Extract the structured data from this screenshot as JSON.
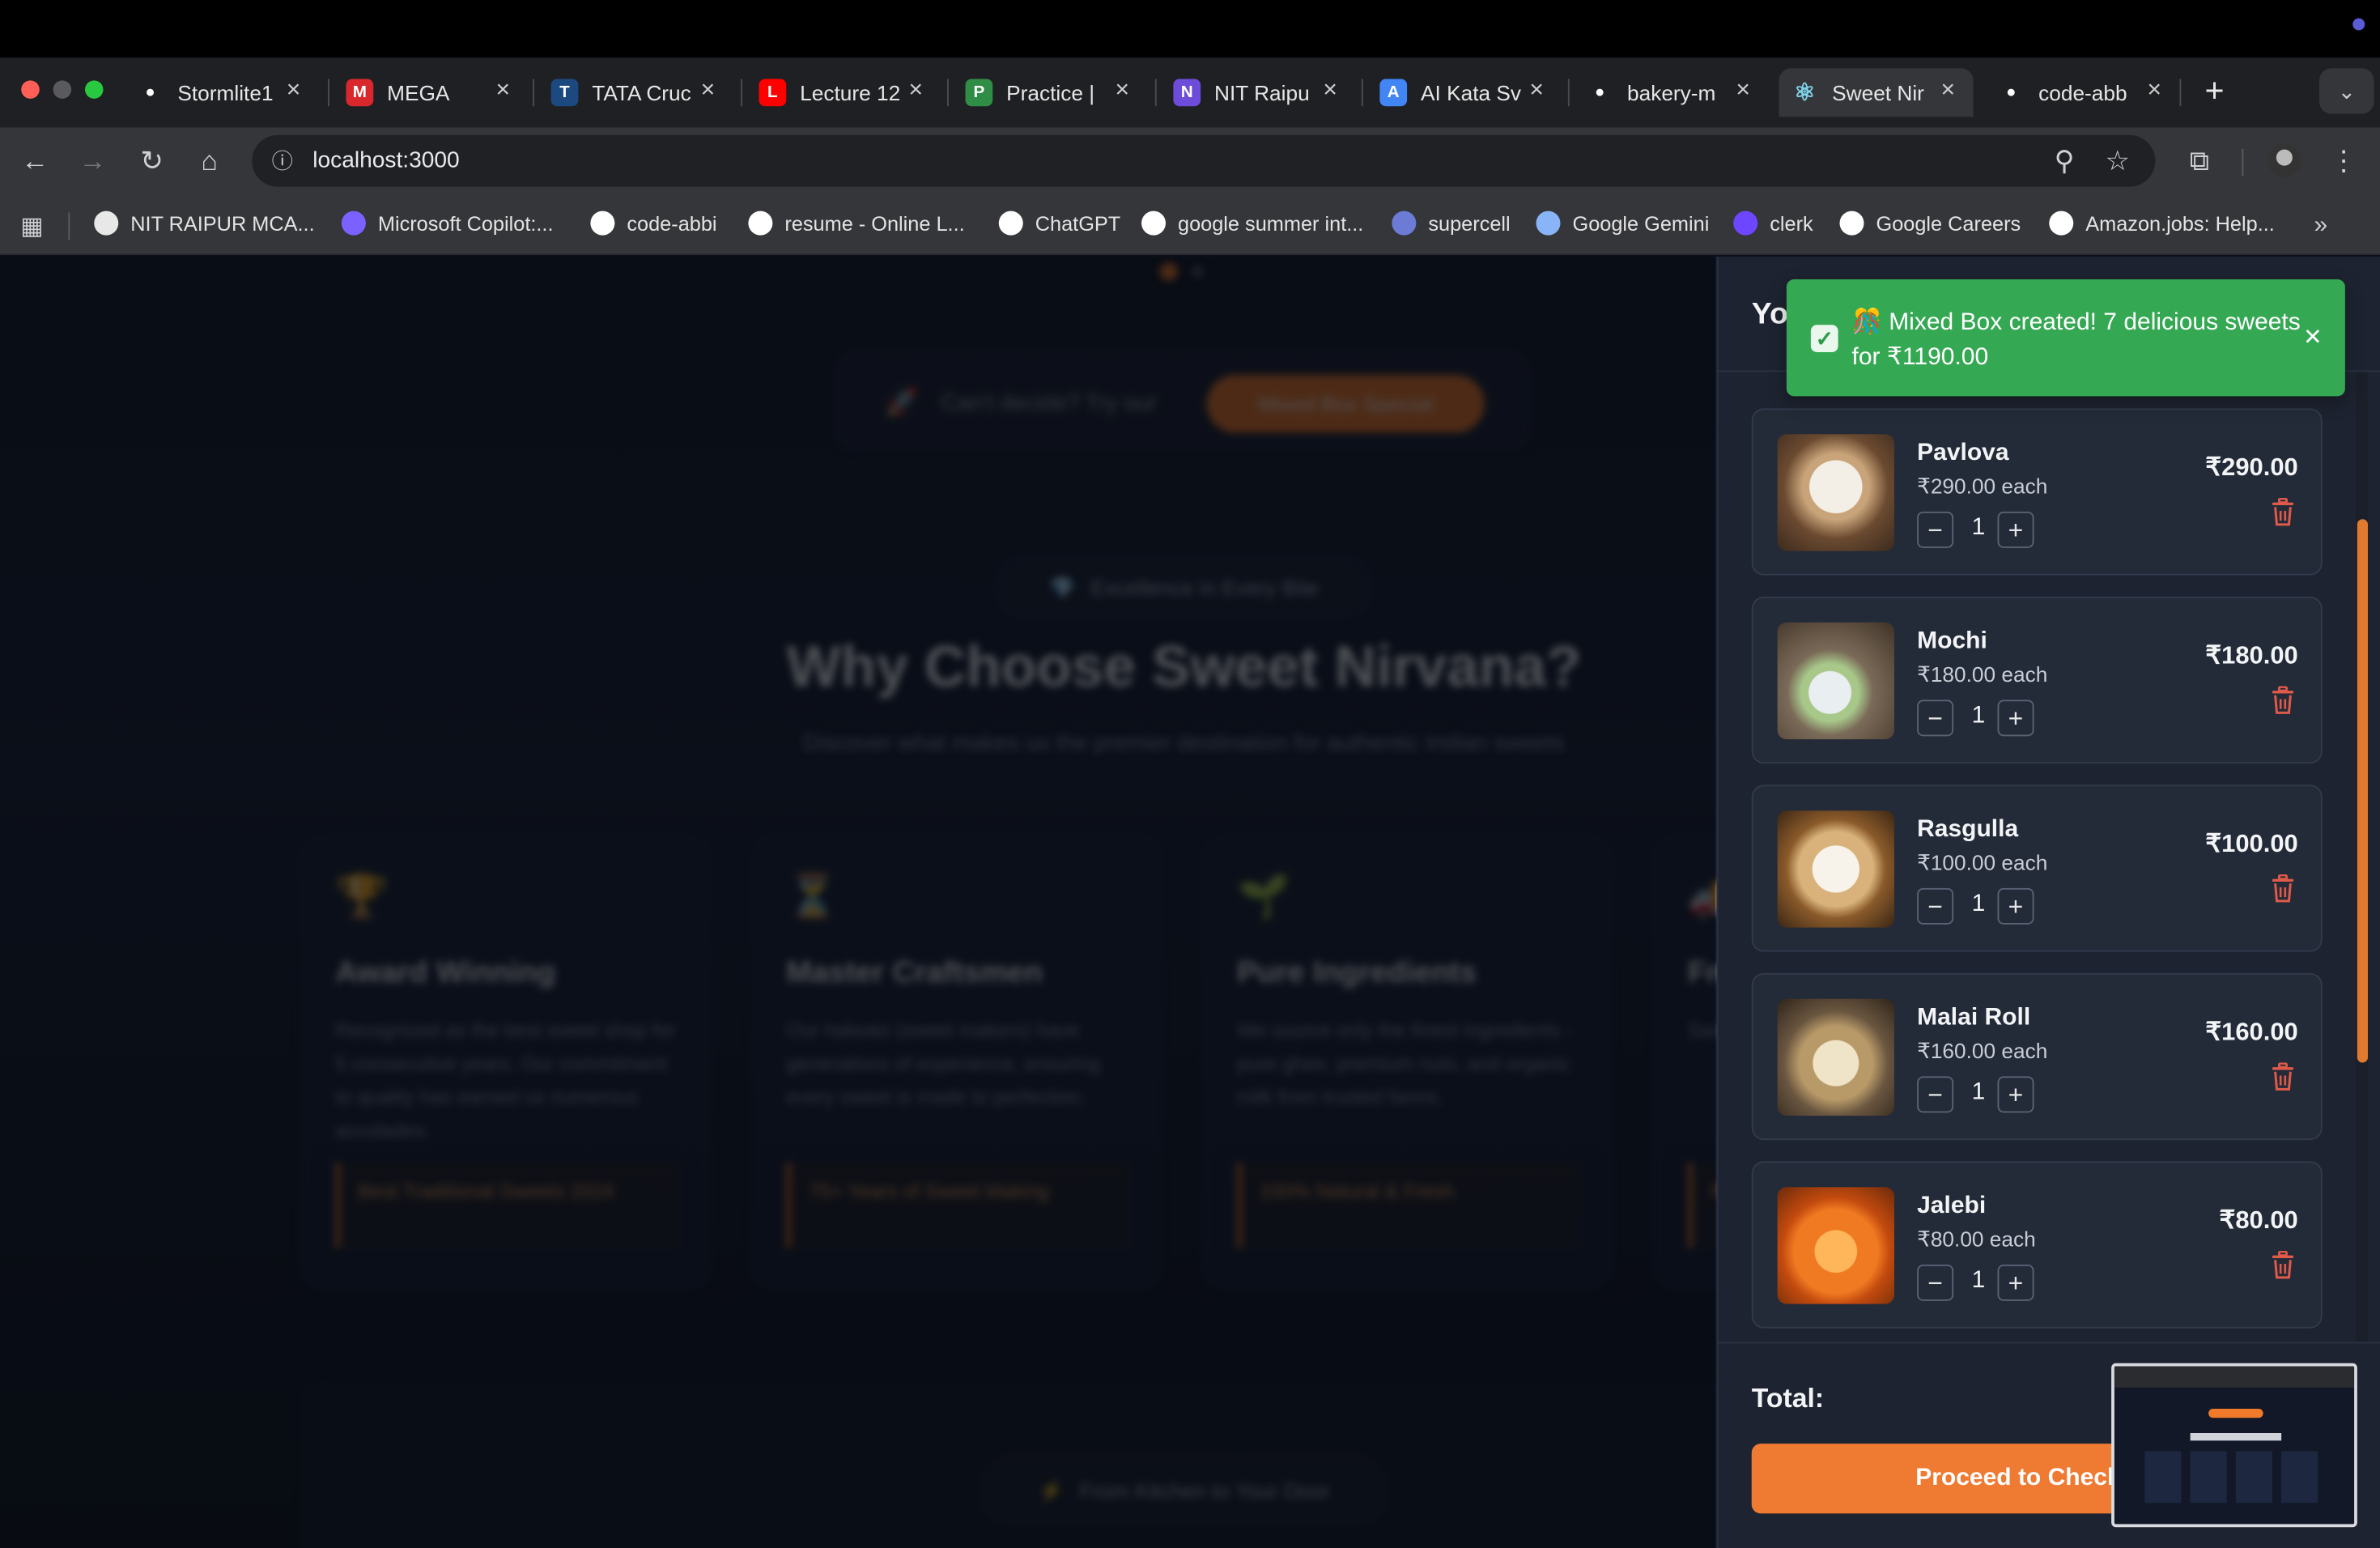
{
  "browser": {
    "tabs": [
      {
        "title": "Stormlite1",
        "icon": "github-icon",
        "color": "#ffffff"
      },
      {
        "title": "MEGA",
        "icon": "mega-icon",
        "color": "#d9272e"
      },
      {
        "title": "TATA Cruc",
        "icon": "unstop-icon",
        "color": "#1c4980"
      },
      {
        "title": "Lecture 12",
        "icon": "youtube-icon",
        "color": "#ff0000"
      },
      {
        "title": "Practice |",
        "icon": "gfg-icon",
        "color": "#2f8d46"
      },
      {
        "title": "NIT Raipu",
        "icon": "form-icon",
        "color": "#6c4cd9"
      },
      {
        "title": "AI Kata Sv",
        "icon": "docs-icon",
        "color": "#4285f4"
      },
      {
        "title": "bakery-m",
        "icon": "github-icon",
        "color": "#ffffff"
      },
      {
        "title": "Sweet Nir",
        "icon": "react-icon",
        "color": "#7fd3e8"
      },
      {
        "title": "code-abb",
        "icon": "github-icon",
        "color": "#ffffff"
      }
    ],
    "url": "localhost:3000",
    "bookmarks": [
      {
        "label": "NIT RAIPUR MCA...",
        "color": "#e8e8e8"
      },
      {
        "label": "Microsoft Copilot:...",
        "color": "#7b61ff"
      },
      {
        "label": "code-abbi",
        "color": "#ffffff"
      },
      {
        "label": "resume - Online L...",
        "color": "#ffffff"
      },
      {
        "label": "ChatGPT",
        "color": "#ffffff"
      },
      {
        "label": "google summer int...",
        "color": "#ffffff"
      },
      {
        "label": "supercell",
        "color": "#6c7bd6"
      },
      {
        "label": "Google Gemini",
        "color": "#8ab4f8"
      },
      {
        "label": "clerk",
        "color": "#6c47ff"
      },
      {
        "label": "Google Careers",
        "color": "#ffffff"
      },
      {
        "label": "Amazon.jobs: Help...",
        "color": "#ffffff"
      }
    ]
  },
  "page": {
    "banner_text": "Can't decide? Try our",
    "banner_button": "Mixed Box Special",
    "pill": "Excellence in Every Bite",
    "heading": "Why Choose Sweet Nirvana?",
    "subheading": "Discover what makes us the premier destination for authentic Indian sweets",
    "features": [
      {
        "icon": "🏆",
        "title": "Award Winning",
        "desc": "Recognized as the best sweet shop for 5 consecutive years. Our commitment to quality has earned us numerous accolades.",
        "badge": "Best Traditional Sweets 2024"
      },
      {
        "icon": "⏳",
        "title": "Master Craftsmen",
        "desc": "Our halwais (sweet makers) have generations of experience, ensuring every sweet is made to perfection.",
        "badge": "75+ Years of Sweet Making"
      },
      {
        "icon": "🌱",
        "title": "Pure Ingredients",
        "desc": "We source only the finest ingredients - pure ghee, premium nuts, and organic milk from trusted farms.",
        "badge": "100% Natural & Fresh"
      },
      {
        "icon": "🚚",
        "title": "Fresh Delivery",
        "desc": "Same-day delivery across the city.",
        "badge": "Free"
      }
    ],
    "bottom_pill": "From Kitchen to Your Door"
  },
  "cart": {
    "title": "Your Cart",
    "items": [
      {
        "name": "Pavlova",
        "each": "₹290.00 each",
        "qty": "1",
        "price": "₹290.00"
      },
      {
        "name": "Mochi",
        "each": "₹180.00 each",
        "qty": "1",
        "price": "₹180.00"
      },
      {
        "name": "Rasgulla",
        "each": "₹100.00 each",
        "qty": "1",
        "price": "₹100.00"
      },
      {
        "name": "Malai Roll",
        "each": "₹160.00 each",
        "qty": "1",
        "price": "₹160.00"
      },
      {
        "name": "Jalebi",
        "each": "₹80.00 each",
        "qty": "1",
        "price": "₹80.00"
      }
    ],
    "total_label": "Total:",
    "checkout": "Proceed to Checkout"
  },
  "toast": {
    "text": "🎊 Mixed Box created! 7 delicious sweets for ₹1190.00",
    "color": "#35a853"
  },
  "colors": {
    "accent": "#ef7a32",
    "trash": "#e05a4a"
  }
}
